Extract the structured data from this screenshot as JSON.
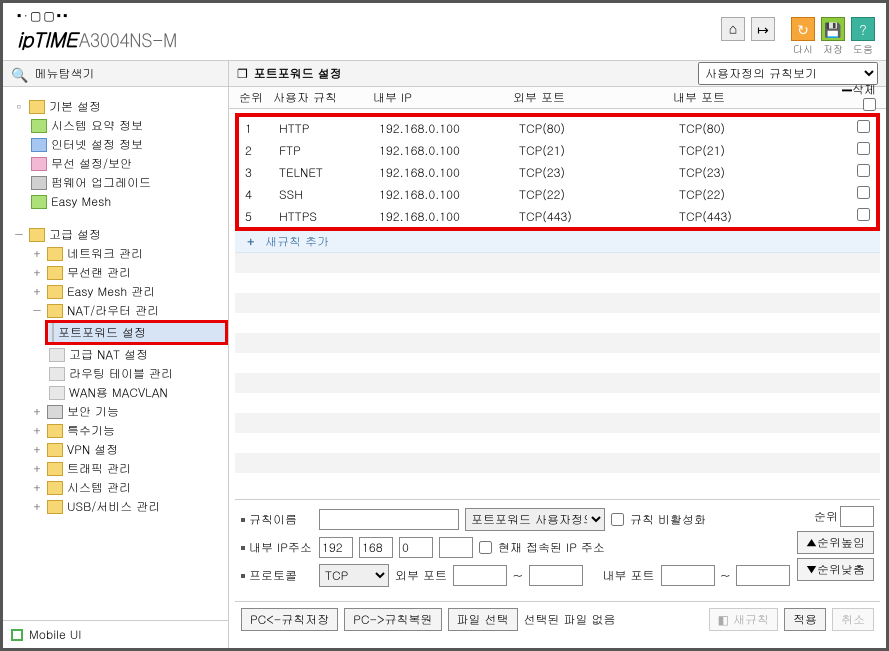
{
  "header": {
    "model": "A3004NS-M",
    "buttons": {
      "home": "",
      "logout": "",
      "refresh": "다시",
      "save": "저장",
      "help": "도움"
    }
  },
  "sidebar": {
    "title": "메뉴탐색기",
    "mobile": "Mobile UI",
    "basic": {
      "label": "기본 설정",
      "items": [
        "시스템 요약 정보",
        "인터넷 설정 정보",
        "무선 설정/보안",
        "펌웨어 업그레이드",
        "Easy Mesh"
      ]
    },
    "adv": {
      "label": "고급 설정",
      "items": [
        "네트워크 관리",
        "무선랜 관리",
        "Easy Mesh 관리"
      ],
      "nat": {
        "label": "NAT/라우터 관리",
        "items": [
          "포트포워드 설정",
          "고급 NAT 설정",
          "라우팅 테이블 관리",
          "WAN용 MACVLAN"
        ]
      },
      "rest": [
        "보안 기능",
        "특수기능",
        "VPN 설정",
        "트래픽 관리",
        "시스템 관리",
        "USB/서비스 관리"
      ]
    }
  },
  "main": {
    "title": "포트포워드 설정",
    "view_select": "사용자정의 규칙보기",
    "cols": {
      "order": "순위",
      "rule": "사용자 규칙",
      "ip": "내부 IP",
      "ext": "외부 포트",
      "int": "내부 포트",
      "del": "삭제"
    },
    "rules": [
      {
        "order": "1",
        "rule": "HTTP",
        "ip": "192.168.0.100",
        "ext": "TCP(80)",
        "int": "TCP(80)"
      },
      {
        "order": "2",
        "rule": "FTP",
        "ip": "192.168.0.100",
        "ext": "TCP(21)",
        "int": "TCP(21)"
      },
      {
        "order": "3",
        "rule": "TELNET",
        "ip": "192.168.0.100",
        "ext": "TCP(23)",
        "int": "TCP(23)"
      },
      {
        "order": "4",
        "rule": "SSH",
        "ip": "192.168.0.100",
        "ext": "TCP(22)",
        "int": "TCP(22)"
      },
      {
        "order": "5",
        "rule": "HTTPS",
        "ip": "192.168.0.100",
        "ext": "TCP(443)",
        "int": "TCP(443)"
      }
    ],
    "add_rule": "새규칙 추가"
  },
  "form": {
    "rule_name": "규칙이름",
    "pf_select": "포트포워드 사용자정의",
    "disable": "규칙 비활성화",
    "int_ip": "내부 IP주소",
    "ip": {
      "a": "192",
      "b": "168",
      "c": "0",
      "d": ""
    },
    "cur_ip": "현재 접속된 IP 주소",
    "proto_lab": "프로토콜",
    "proto": "TCP",
    "ext_port": "외부 포트",
    "int_port": "내부 포트",
    "order_lab": "순위",
    "order_up": "▲순위높임",
    "order_dn": "▼순위낮춤"
  },
  "footer": {
    "save_rule": "PC<-규칙저장",
    "load_rule": "PC->규칙복원",
    "file_sel": "파일 선택",
    "no_file": "선택된 파일 없음",
    "new_rule": "새규칙",
    "apply": "적용",
    "cancel": "취소"
  }
}
